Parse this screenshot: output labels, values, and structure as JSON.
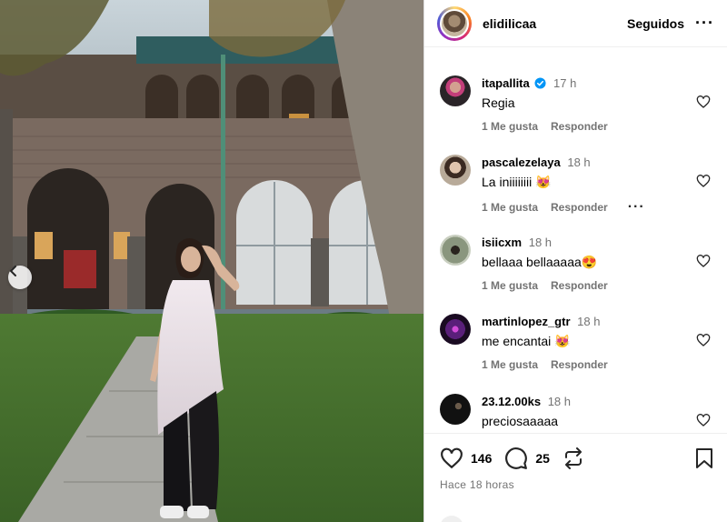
{
  "post": {
    "username": "elidilicaa",
    "follow_label": "Seguidos",
    "more_label": "···"
  },
  "comments": [
    {
      "user": "itapallita",
      "verified": true,
      "time": "17 h",
      "text": "Regia",
      "like_label": "1 Me gusta",
      "reply_label": "Responder",
      "avatar_color": "#2a2428"
    },
    {
      "user": "pascalezelaya",
      "verified": false,
      "time": "18 h",
      "text": "La iniiiiiiii 😻",
      "like_label": "1 Me gusta",
      "reply_label": "Responder",
      "more_label": "···",
      "avatar_color": "#8d7e6e"
    },
    {
      "user": "isiicxm",
      "verified": false,
      "time": "18 h",
      "text": "bellaaa bellaaaaa😍",
      "like_label": "1 Me gusta",
      "reply_label": "Responder",
      "avatar_color": "#6e7a63"
    },
    {
      "user": "martinlopez_gtr",
      "verified": false,
      "time": "18 h",
      "text": "me encantai 😻",
      "like_label": "1 Me gusta",
      "reply_label": "Responder",
      "avatar_color": "#3a1a55"
    },
    {
      "user": "23.12.00ks",
      "verified": false,
      "time": "18 h",
      "text": "preciosaaaaa",
      "like_label": "",
      "reply_label": "",
      "avatar_color": "#111111"
    }
  ],
  "footer": {
    "likes": "146",
    "comments": "25",
    "time_ago": "Hace 18 horas"
  },
  "colors": {
    "verified": "#0095f6",
    "muted": "#737373"
  },
  "icons": [
    "chevron-left-icon",
    "heart-icon",
    "comment-icon",
    "share-icon",
    "bookmark-icon",
    "verified-icon"
  ]
}
